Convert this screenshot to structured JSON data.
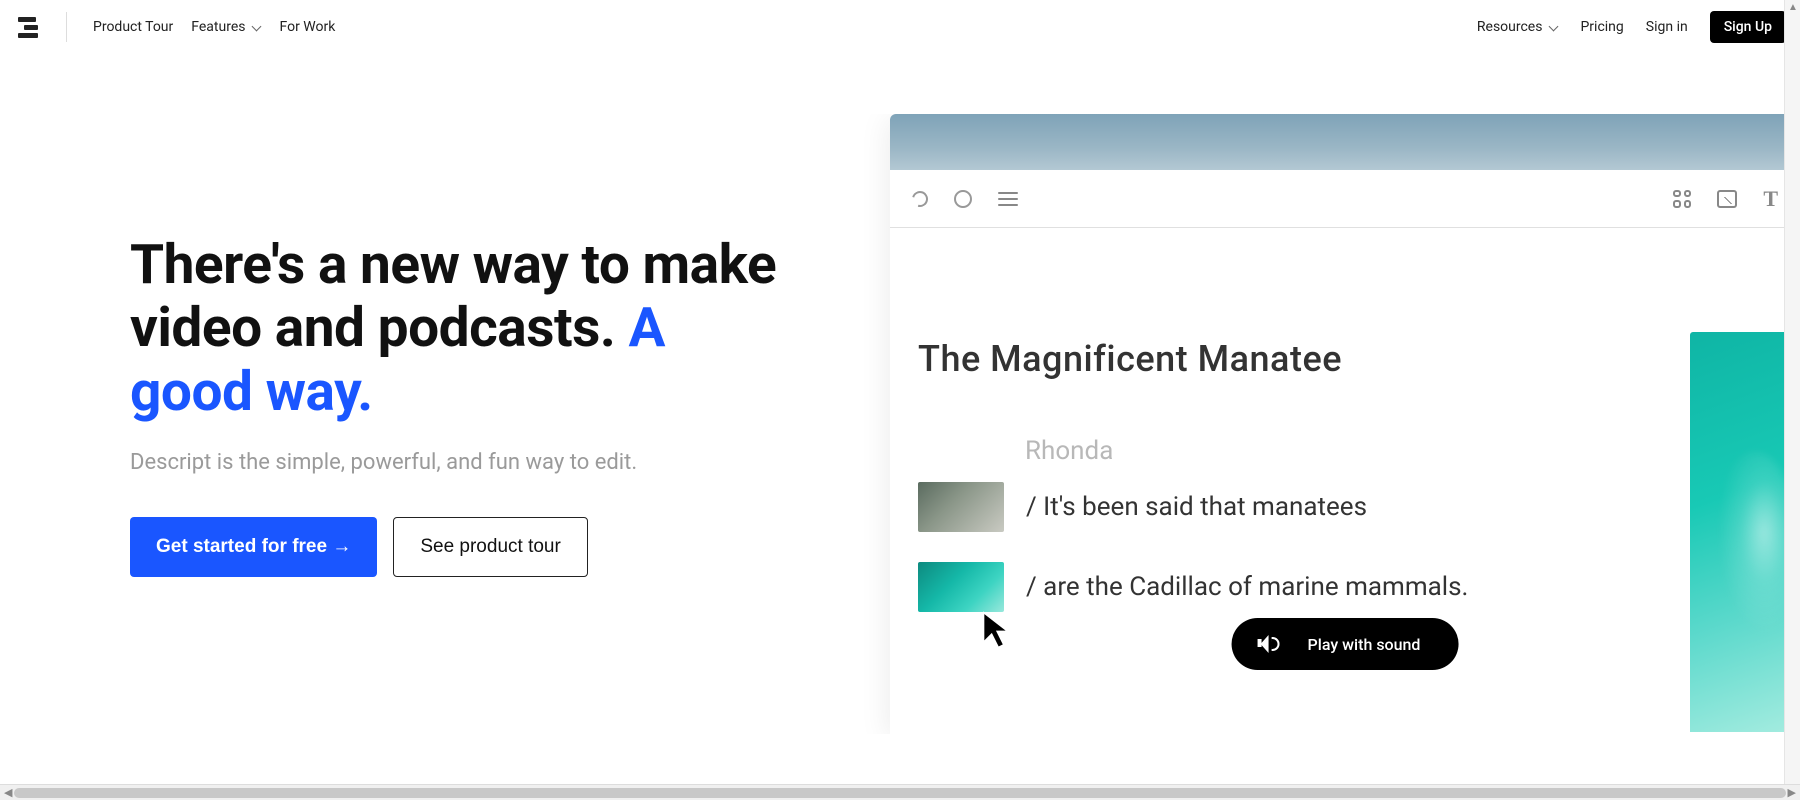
{
  "nav": {
    "product_tour": "Product Tour",
    "features": "Features",
    "for_work": "For Work",
    "resources": "Resources",
    "pricing": "Pricing",
    "sign_in": "Sign in",
    "sign_up": "Sign Up"
  },
  "hero": {
    "headline_plain": "There's a new way to make video and podcasts. ",
    "headline_accent": "A good way.",
    "subhead": "Descript is the simple, powerful, and fun way to edit.",
    "cta_primary": "Get started for free →",
    "cta_secondary": "See product tour"
  },
  "demo": {
    "title": "The Magnificent Manatee",
    "speaker": "Rhonda",
    "line1": "/ It's been said that manatees",
    "line2": "/ are the Cadillac of marine mammals.",
    "play_label": "Play with sound",
    "toolbar_text_glyph": "T"
  },
  "colors": {
    "accent_blue": "#1a56ff",
    "text_muted": "#9a9a9a",
    "black": "#000000"
  }
}
